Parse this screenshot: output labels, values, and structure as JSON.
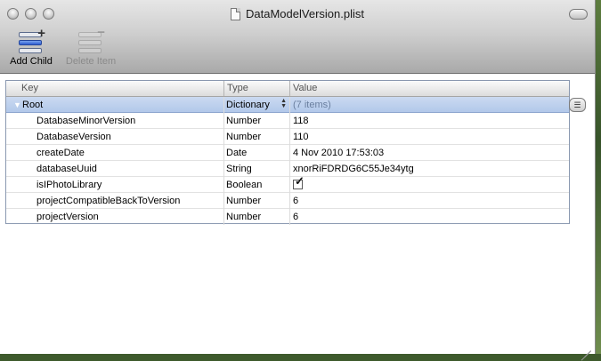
{
  "window": {
    "title": "DataModelVersion.plist"
  },
  "toolbar": {
    "add_child_label": "Add Child",
    "delete_item_label": "Delete Item"
  },
  "table": {
    "headers": {
      "key": "Key",
      "type": "Type",
      "value": "Value"
    },
    "root": {
      "key": "Root",
      "type": "Dictionary",
      "value": "(7 items)"
    },
    "rows": [
      {
        "key": "DatabaseMinorVersion",
        "type": "Number",
        "value": "118"
      },
      {
        "key": "DatabaseVersion",
        "type": "Number",
        "value": "110"
      },
      {
        "key": "createDate",
        "type": "Date",
        "value": "4 Nov 2010 17:53:03"
      },
      {
        "key": "databaseUuid",
        "type": "String",
        "value": "xnorRiFDRDG6C55Je34ytg"
      },
      {
        "key": "isIPhotoLibrary",
        "type": "Boolean",
        "value": ""
      },
      {
        "key": "projectCompatibleBackToVersion",
        "type": "Number",
        "value": "6"
      },
      {
        "key": "projectVersion",
        "type": "Number",
        "value": "6"
      }
    ],
    "checkbox_checked": true
  },
  "icons": {
    "disclosure": "disclosure-triangle-down-icon",
    "stepper": "up-down-stepper-icon",
    "row_action": "row-action-menu-icon"
  }
}
